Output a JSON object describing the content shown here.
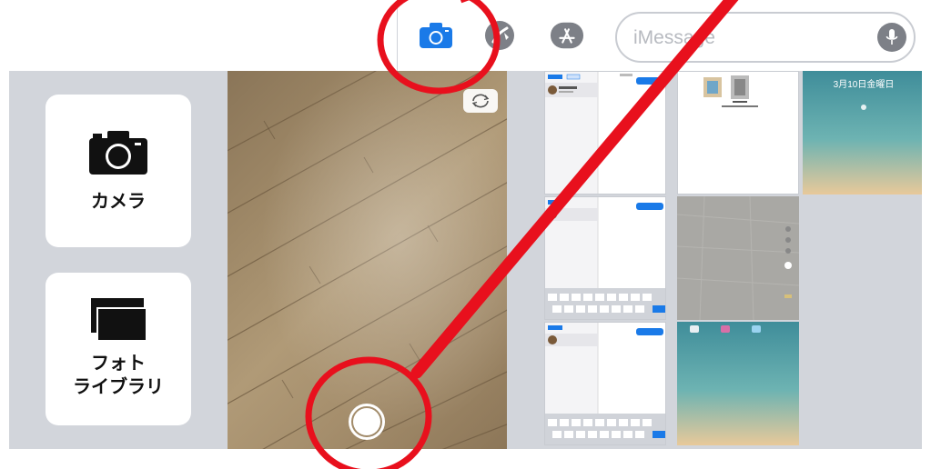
{
  "toolbar": {
    "icons": [
      "camera-icon",
      "digital-touch-icon",
      "app-store-icon",
      "microphone-icon"
    ],
    "message_placeholder": "iMessage"
  },
  "drawer": {
    "camera_tile_label": "カメラ",
    "photo_library_tile_label": "フォト\nライブラリ",
    "photo_library_line1": "フォト",
    "photo_library_line2": "ライブラリ"
  },
  "photos": {
    "date_text": "3月10日金曜日"
  },
  "colors": {
    "accent": "#1a7ae8",
    "annotation_red": "#e8101d",
    "drawer_background": "#d2d5db"
  }
}
